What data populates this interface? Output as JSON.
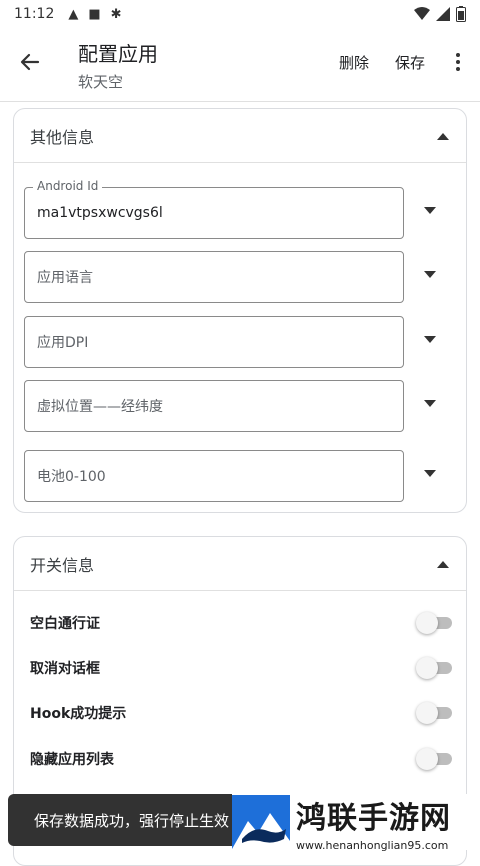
{
  "status_bar": {
    "time": "11:12"
  },
  "app_bar": {
    "title": "配置应用",
    "subtitle": "软天空",
    "delete_label": "删除",
    "save_label": "保存"
  },
  "other_info": {
    "title": "其他信息",
    "fields": [
      {
        "label": "Android Id",
        "value": "ma1vtpsxwcvgs6l"
      },
      {
        "placeholder": "应用语言"
      },
      {
        "placeholder": "应用DPI"
      },
      {
        "placeholder": "虚拟位置——经纬度"
      },
      {
        "placeholder": "电池0-100"
      }
    ]
  },
  "switch_info": {
    "title": "开关信息",
    "switches": [
      {
        "label": "空白通行证",
        "on": false
      },
      {
        "label": "取消对话框",
        "on": false
      },
      {
        "label": "Hook成功提示",
        "on": false
      },
      {
        "label": "隐藏应用列表",
        "on": false
      }
    ]
  },
  "toast": {
    "text": "保存数据成功，强行停止生效"
  },
  "watermark": {
    "title": "鸿联手游网",
    "url": "www.henanhonglian95.com"
  },
  "colors": {
    "toast_bg": "#323232",
    "toggle_off_track": "#bdbdbd",
    "watermark_blue": "#1e6fd9"
  }
}
